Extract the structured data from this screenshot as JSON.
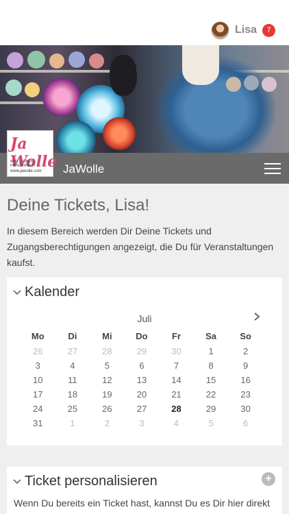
{
  "header": {
    "username": "Lisa",
    "notification_count": "7"
  },
  "brand": {
    "logo_text": "Ja Wolle",
    "logo_tagline": "WIR LIEBEN HANDARBEIT",
    "logo_url": "www.jawolle.com",
    "name": "JaWolle"
  },
  "page": {
    "title": "Deine Tickets, Lisa!",
    "intro": "In diesem Bereich werden Dir Deine Tickets und Zugangsberechtigungen angezeigt, die Du für Veranstaltungen kaufst."
  },
  "calendar": {
    "title": "Kalender",
    "month": "Juli",
    "weekdays": [
      "Mo",
      "Di",
      "Mi",
      "Do",
      "Fr",
      "Sa",
      "So"
    ],
    "weeks": [
      [
        "26",
        "27",
        "28",
        "29",
        "30",
        "1",
        "2"
      ],
      [
        "3",
        "4",
        "5",
        "6",
        "7",
        "8",
        "9"
      ],
      [
        "10",
        "11",
        "12",
        "13",
        "14",
        "15",
        "16"
      ],
      [
        "17",
        "18",
        "19",
        "20",
        "21",
        "22",
        "23"
      ],
      [
        "24",
        "25",
        "26",
        "27",
        "28",
        "29",
        "30"
      ],
      [
        "31",
        "1",
        "2",
        "3",
        "4",
        "5",
        "6"
      ]
    ],
    "today": "28"
  },
  "ticket_card": {
    "title": "Ticket personalisieren",
    "text": "Wenn Du bereits ein Ticket hast, kannst Du es Dir hier direkt"
  },
  "colors": {
    "brand_bar": "#6a6a6a",
    "badge": "#e53935",
    "logo_accent": "#d24a6e"
  }
}
